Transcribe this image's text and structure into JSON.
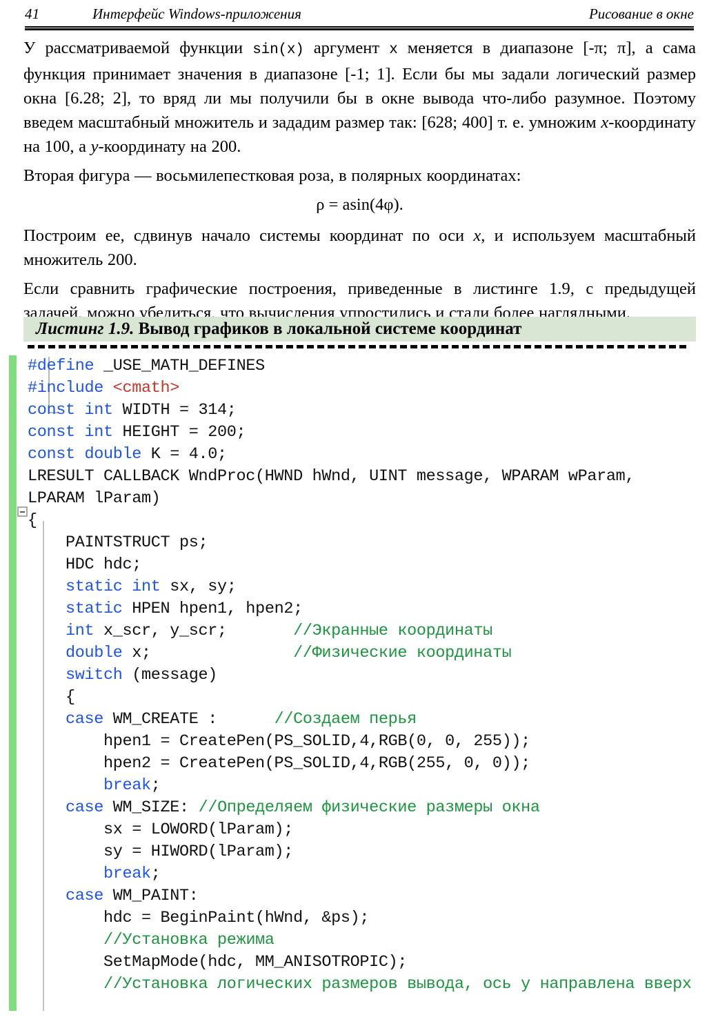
{
  "page": {
    "folio": "41",
    "running_head_left": "Интерфейс Windows-приложения",
    "running_head_right": "Рисование в окне"
  },
  "body": {
    "paragraph_1": {
      "seg_1": "У рассматриваемой функции ",
      "mono_1": "sin(x)",
      "seg_2": " аргумент ",
      "mono_2": "x",
      "seg_3": " меняется в диапазоне [-π; π], а сама функция принимает значения в диапазоне [-1; 1]. Если бы мы задали логический размер окна [6.28; 2], то вряд ли мы получили бы в окне вывода что-либо разумное. Поэтому введем масштабный множитель и зададим размер так: [628; 400] т. е. умножим ",
      "ital_1": "x",
      "seg_4": "-координату на 100, а ",
      "ital_2": "y",
      "seg_5": "-координату на 200."
    },
    "paragraph_2": "Вторая фигура — восьмилепестковая роза, в полярных координатах:",
    "formula": "ρ = asin(4φ).",
    "paragraph_3": {
      "seg_1": "Построим ее, сдвинув начало системы координат по оси ",
      "ital_1": "x",
      "seg_2": ", и используем масштабный множитель 200."
    },
    "paragraph_4": "Если сравнить графические построения, приведенные в листинге 1.9, с предыдущей задачей, можно убедиться, что вычисления упростились и стали более наглядными."
  },
  "listing": {
    "caption_number": "Листинг 1.9.",
    "caption_title": " Вывод графиков в локальной системе координат",
    "header_bg": "#d9e6d4",
    "colors": {
      "keyword": "#1f56dd",
      "string": "#c0392b",
      "comment": "#1f9440",
      "plain": "#111111",
      "change_bar": "#82dd82"
    },
    "fold_icon": "collapse-minus-icon",
    "code_lines": [
      [
        {
          "t": "#define",
          "c": "pp"
        },
        {
          "t": " _USE_MATH_DEFINES",
          "c": "pln"
        }
      ],
      [
        {
          "t": "#include",
          "c": "pp"
        },
        {
          "t": " ",
          "c": "pln"
        },
        {
          "t": "<cmath>",
          "c": "str"
        }
      ],
      [
        {
          "t": "const int",
          "c": "kw"
        },
        {
          "t": " WIDTH = 314;",
          "c": "pln"
        }
      ],
      [
        {
          "t": "const int",
          "c": "kw"
        },
        {
          "t": " HEIGHT = 200;",
          "c": "pln"
        }
      ],
      [
        {
          "t": "const double",
          "c": "kw"
        },
        {
          "t": " K = 4.0;",
          "c": "pln"
        }
      ],
      [
        {
          "t": "LRESULT CALLBACK WndProc(HWND hWnd, UINT message, WPARAM wParam,",
          "c": "pln"
        }
      ],
      [
        {
          "t": "LPARAM lParam)",
          "c": "pln"
        }
      ],
      [
        {
          "t": "{",
          "c": "pln"
        }
      ],
      [
        {
          "t": "    PAINTSTRUCT ps;",
          "c": "pln"
        }
      ],
      [
        {
          "t": "    HDC hdc;",
          "c": "pln"
        }
      ],
      [
        {
          "t": "    ",
          "c": "pln"
        },
        {
          "t": "static int",
          "c": "kw"
        },
        {
          "t": " sx, sy;",
          "c": "pln"
        }
      ],
      [
        {
          "t": "    ",
          "c": "pln"
        },
        {
          "t": "static",
          "c": "kw"
        },
        {
          "t": " HPEN hpen1, hpen2;",
          "c": "pln"
        }
      ],
      [
        {
          "t": "    ",
          "c": "pln"
        },
        {
          "t": "int",
          "c": "kw"
        },
        {
          "t": " x_scr, y_scr;       ",
          "c": "pln"
        },
        {
          "t": "//Экранные координаты",
          "c": "cmt"
        }
      ],
      [
        {
          "t": "    ",
          "c": "pln"
        },
        {
          "t": "double",
          "c": "kw"
        },
        {
          "t": " x;               ",
          "c": "pln"
        },
        {
          "t": "//Физические координаты",
          "c": "cmt"
        }
      ],
      [
        {
          "t": "    ",
          "c": "pln"
        },
        {
          "t": "switch",
          "c": "kw"
        },
        {
          "t": " (message)",
          "c": "pln"
        }
      ],
      [
        {
          "t": "    {",
          "c": "pln"
        }
      ],
      [
        {
          "t": "    ",
          "c": "pln"
        },
        {
          "t": "case",
          "c": "kw"
        },
        {
          "t": " WM_CREATE :      ",
          "c": "pln"
        },
        {
          "t": "//Создаем перья",
          "c": "cmt"
        }
      ],
      [
        {
          "t": "        hpen1 = CreatePen(PS_SOLID,4,RGB(0, 0, 255));",
          "c": "pln"
        }
      ],
      [
        {
          "t": "        hpen2 = CreatePen(PS_SOLID,4,RGB(255, 0, 0));",
          "c": "pln"
        }
      ],
      [
        {
          "t": "        ",
          "c": "pln"
        },
        {
          "t": "break",
          "c": "kw"
        },
        {
          "t": ";",
          "c": "pln"
        }
      ],
      [
        {
          "t": "    ",
          "c": "pln"
        },
        {
          "t": "case",
          "c": "kw"
        },
        {
          "t": " WM_SIZE: ",
          "c": "pln"
        },
        {
          "t": "//Определяем физические размеры окна",
          "c": "cmt"
        }
      ],
      [
        {
          "t": "        sx = LOWORD(lParam);",
          "c": "pln"
        }
      ],
      [
        {
          "t": "        sy = HIWORD(lParam);",
          "c": "pln"
        }
      ],
      [
        {
          "t": "        ",
          "c": "pln"
        },
        {
          "t": "break",
          "c": "kw"
        },
        {
          "t": ";",
          "c": "pln"
        }
      ],
      [
        {
          "t": "    ",
          "c": "pln"
        },
        {
          "t": "case",
          "c": "kw"
        },
        {
          "t": " WM_PAINT:",
          "c": "pln"
        }
      ],
      [
        {
          "t": "        hdc = BeginPaint(hWnd, &ps);",
          "c": "pln"
        }
      ],
      [
        {
          "t": "        ",
          "c": "pln"
        },
        {
          "t": "//Установка режима",
          "c": "cmt"
        }
      ],
      [
        {
          "t": "        SetMapMode(hdc, MM_ANISOTROPIC);",
          "c": "pln"
        }
      ],
      [
        {
          "t": "        ",
          "c": "pln"
        },
        {
          "t": "//Установка логических размеров вывода, ось y направлена вверх",
          "c": "cmt"
        }
      ]
    ]
  }
}
